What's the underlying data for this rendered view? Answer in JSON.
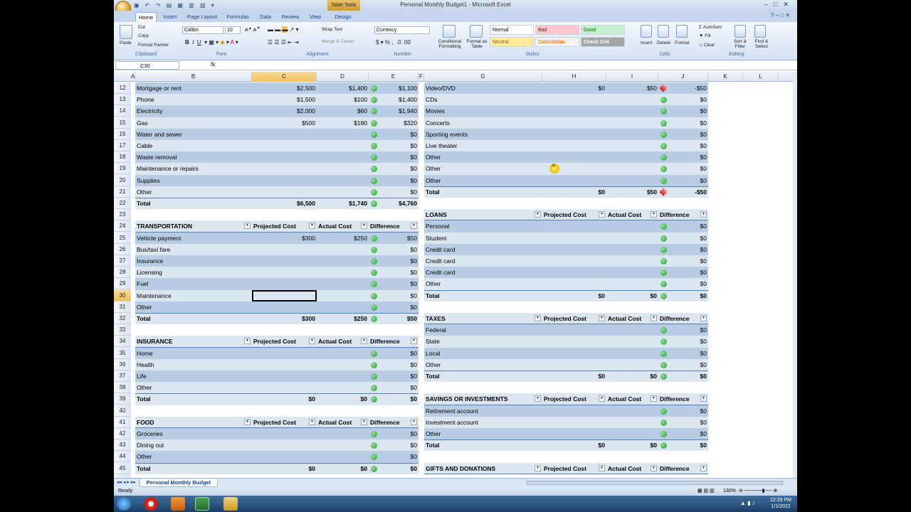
{
  "window": {
    "title": "Personal Monthly Budget1 - Microsoft Excel",
    "context_tab": "Table Tools"
  },
  "ribbon": {
    "tabs": [
      "Home",
      "Insert",
      "Page Layout",
      "Formulas",
      "Data",
      "Review",
      "View",
      "Design"
    ],
    "active_tab": "Home",
    "clipboard": {
      "paste": "Paste",
      "cut": "Cut",
      "copy": "Copy",
      "format_painter": "Format Painter",
      "label": "Clipboard"
    },
    "font": {
      "name": "Calibri",
      "size": "10",
      "label": "Font"
    },
    "alignment": {
      "wrap": "Wrap Text",
      "merge": "Merge & Center",
      "label": "Alignment"
    },
    "number": {
      "format": "Currency",
      "label": "Number"
    },
    "styles": {
      "conditional": "Conditional Formatting",
      "format_table": "Format as Table",
      "normal": "Normal",
      "bad": "Bad",
      "good": "Good",
      "neutral": "Neutral",
      "calculation": "Calculation",
      "check_cell": "Check Cell",
      "label": "Styles"
    },
    "cells": {
      "insert": "Insert",
      "delete": "Delete",
      "format": "Format",
      "label": "Cells"
    },
    "editing": {
      "autosum": "AutoSum",
      "fill": "Fill",
      "clear": "Clear",
      "sort": "Sort & Filter",
      "find": "Find & Select",
      "label": "Editing"
    }
  },
  "formula_bar": {
    "name_box": "C30",
    "fx": "fx",
    "value": ""
  },
  "columns": [
    "A",
    "B",
    "C",
    "D",
    "E",
    "F",
    "G",
    "H",
    "I",
    "J",
    "K",
    "L"
  ],
  "selected_column": "C",
  "rows": [
    "12",
    "13",
    "14",
    "15",
    "16",
    "17",
    "18",
    "19",
    "20",
    "21",
    "22",
    "23",
    "24",
    "25",
    "26",
    "27",
    "28",
    "29",
    "30",
    "31",
    "32",
    "33",
    "34",
    "35",
    "36",
    "37",
    "38",
    "39",
    "40",
    "41",
    "42",
    "43",
    "44",
    "45"
  ],
  "selected_row": "30",
  "left": {
    "housing": [
      {
        "label": "Mortgage or rent",
        "proj": "$2,500",
        "act": "$1,400",
        "diff": "$1,100"
      },
      {
        "label": "Phone",
        "proj": "$1,500",
        "act": "$100",
        "diff": "$1,400"
      },
      {
        "label": "Electricity",
        "proj": "$2,000",
        "act": "$60",
        "diff": "$1,940"
      },
      {
        "label": "Gas",
        "proj": "$500",
        "act": "$180",
        "diff": "$320"
      },
      {
        "label": "Water and sewer",
        "proj": "",
        "act": "",
        "diff": "$0"
      },
      {
        "label": "Cable",
        "proj": "",
        "act": "",
        "diff": "$0"
      },
      {
        "label": "Waste removal",
        "proj": "",
        "act": "",
        "diff": "$0"
      },
      {
        "label": "Maintenance or repairs",
        "proj": "",
        "act": "",
        "diff": "$0"
      },
      {
        "label": "Supplies",
        "proj": "",
        "act": "",
        "diff": "$0"
      },
      {
        "label": "Other",
        "proj": "",
        "act": "",
        "diff": "$0"
      }
    ],
    "housing_total": {
      "label": "Total",
      "proj": "$6,500",
      "act": "$1,740",
      "diff": "$4,760"
    },
    "transportation": {
      "header": [
        "TRANSPORTATION",
        "Projected Cost",
        "Actual Cost",
        "Difference"
      ],
      "rows": [
        {
          "label": "Vehicle payment",
          "proj": "$300",
          "act": "$250",
          "diff": "$50"
        },
        {
          "label": "Bus/taxi fare",
          "proj": "",
          "act": "",
          "diff": "$0"
        },
        {
          "label": "Insurance",
          "proj": "",
          "act": "",
          "diff": "$0"
        },
        {
          "label": "Licensing",
          "proj": "",
          "act": "",
          "diff": "$0"
        },
        {
          "label": "Fuel",
          "proj": "",
          "act": "",
          "diff": "$0"
        },
        {
          "label": "Maintenance",
          "proj": "",
          "act": "",
          "diff": "$0"
        },
        {
          "label": "Other",
          "proj": "",
          "act": "",
          "diff": "$0"
        }
      ],
      "total": {
        "label": "Total",
        "proj": "$300",
        "act": "$250",
        "diff": "$50"
      }
    },
    "insurance": {
      "header": [
        "INSURANCE",
        "Projected Cost",
        "Actual Cost",
        "Difference"
      ],
      "rows": [
        {
          "label": "Home",
          "proj": "",
          "act": "",
          "diff": "$0"
        },
        {
          "label": "Health",
          "proj": "",
          "act": "",
          "diff": "$0"
        },
        {
          "label": "Life",
          "proj": "",
          "act": "",
          "diff": "$0"
        },
        {
          "label": "Other",
          "proj": "",
          "act": "",
          "diff": "$0"
        }
      ],
      "total": {
        "label": "Total",
        "proj": "$0",
        "act": "$0",
        "diff": "$0"
      }
    },
    "food": {
      "header": [
        "FOOD",
        "Projected Cost",
        "Actual Cost",
        "Difference"
      ],
      "rows": [
        {
          "label": "Groceries",
          "proj": "",
          "act": "",
          "diff": "$0"
        },
        {
          "label": "Dining out",
          "proj": "",
          "act": "",
          "diff": "$0"
        },
        {
          "label": "Other",
          "proj": "",
          "act": "",
          "diff": "$0"
        }
      ],
      "total": {
        "label": "Total",
        "proj": "$0",
        "act": "$0",
        "diff": "$0"
      }
    }
  },
  "right": {
    "entertainment": [
      {
        "label": "Video/DVD",
        "proj": "$0",
        "act": "$50",
        "diff": "-$50",
        "flag": "red"
      },
      {
        "label": "CDs",
        "proj": "",
        "act": "",
        "diff": "$0",
        "flag": "green"
      },
      {
        "label": "Movies",
        "proj": "",
        "act": "",
        "diff": "$0",
        "flag": "green"
      },
      {
        "label": "Concerts",
        "proj": "",
        "act": "",
        "diff": "$0",
        "flag": "green"
      },
      {
        "label": "Sporting events",
        "proj": "",
        "act": "",
        "diff": "$0",
        "flag": "green"
      },
      {
        "label": "Live theater",
        "proj": "",
        "act": "",
        "diff": "$0",
        "flag": "green"
      },
      {
        "label": "Other",
        "proj": "",
        "act": "",
        "diff": "$0",
        "flag": "green"
      },
      {
        "label": "Other",
        "proj": "",
        "act": "",
        "diff": "$0",
        "flag": "green"
      },
      {
        "label": "Other",
        "proj": "",
        "act": "",
        "diff": "$0",
        "flag": "green"
      }
    ],
    "entertainment_total": {
      "label": "Total",
      "proj": "$0",
      "act": "$50",
      "diff": "-$50",
      "flag": "red"
    },
    "loans": {
      "header": [
        "LOANS",
        "Projected Cost",
        "Actual Cost",
        "Difference"
      ],
      "rows": [
        {
          "label": "Personal",
          "proj": "",
          "act": "",
          "diff": "$0"
        },
        {
          "label": "Student",
          "proj": "",
          "act": "",
          "diff": "$0"
        },
        {
          "label": "Credit card",
          "proj": "",
          "act": "",
          "diff": "$0"
        },
        {
          "label": "Credit card",
          "proj": "",
          "act": "",
          "diff": "$0"
        },
        {
          "label": "Credit card",
          "proj": "",
          "act": "",
          "diff": "$0"
        },
        {
          "label": "Other",
          "proj": "",
          "act": "",
          "diff": "$0"
        }
      ],
      "total": {
        "label": "Total",
        "proj": "$0",
        "act": "$0",
        "diff": "$0"
      }
    },
    "taxes": {
      "header": [
        "TAXES",
        "Projected Cost",
        "Actual Cost",
        "Difference"
      ],
      "rows": [
        {
          "label": "Federal",
          "proj": "",
          "act": "",
          "diff": "$0"
        },
        {
          "label": "State",
          "proj": "",
          "act": "",
          "diff": "$0"
        },
        {
          "label": "Local",
          "proj": "",
          "act": "",
          "diff": "$0"
        },
        {
          "label": "Other",
          "proj": "",
          "act": "",
          "diff": "$0"
        }
      ],
      "total": {
        "label": "Total",
        "proj": "$0",
        "act": "$0",
        "diff": "$0"
      }
    },
    "savings": {
      "header": [
        "SAVINGS OR INVESTMENTS",
        "Projected Cost",
        "Actual Cost",
        "Difference"
      ],
      "rows": [
        {
          "label": "Retirement account",
          "proj": "",
          "act": "",
          "diff": "$0"
        },
        {
          "label": "Investment account",
          "proj": "",
          "act": "",
          "diff": "$0"
        },
        {
          "label": "Other",
          "proj": "",
          "act": "",
          "diff": "$0"
        }
      ],
      "total": {
        "label": "Total",
        "proj": "$0",
        "act": "$0",
        "diff": "$0"
      }
    },
    "gifts": {
      "header": [
        "GIFTS AND DONATIONS",
        "Projected Cost",
        "Actual Cost",
        "Difference"
      ]
    }
  },
  "sheet_tab": "Personal Monthly Budget",
  "status": {
    "ready": "Ready",
    "zoom": "130%"
  },
  "clock": {
    "time": "12:29 PM",
    "date": "1/1/2022"
  },
  "colors": {
    "band": "#b8cce4",
    "light": "#dce6f1",
    "selected": "#f1c15a",
    "ok": "#2a9a3a",
    "bad": "#d42020"
  }
}
